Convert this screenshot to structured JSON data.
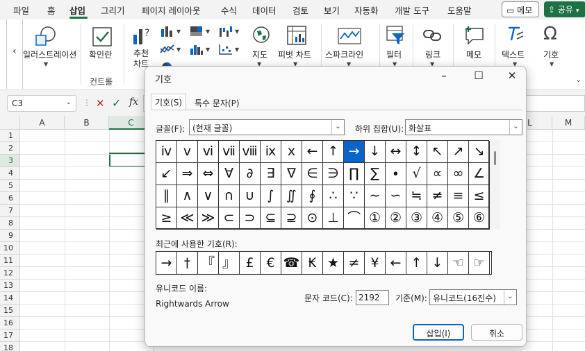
{
  "ribbon_tabs": [
    {
      "label": "파일",
      "active": false
    },
    {
      "label": "홈",
      "active": false
    },
    {
      "label": "삽입",
      "active": true
    },
    {
      "label": "그리기",
      "active": false
    },
    {
      "label": "페이지 레이아웃",
      "active": false
    },
    {
      "label": "수식",
      "active": false
    },
    {
      "label": "데이터",
      "active": false
    },
    {
      "label": "검토",
      "active": false
    },
    {
      "label": "보기",
      "active": false
    },
    {
      "label": "자동화",
      "active": false
    },
    {
      "label": "개발 도구",
      "active": false
    },
    {
      "label": "도움말",
      "active": false
    }
  ],
  "top_buttons": {
    "memo": "메모",
    "share": "공유"
  },
  "ribbon": {
    "scroll_left": "‹",
    "illustrations": "일러스트레이션",
    "checkbox": "확인란",
    "controls_group": "컨트롤",
    "recommended_charts": "추천 차트",
    "map": "지도",
    "pivot_chart": "피벗 차트",
    "sparklines": "스파크라인",
    "filter": "필터",
    "link": "링크",
    "comment": "메모",
    "text": "텍스트",
    "symbol": "기호"
  },
  "formula_bar": {
    "name_box": "C3",
    "cancel": "✕",
    "enter": "✓",
    "fx": "fx"
  },
  "sheet": {
    "columns": [
      "A",
      "B",
      "C",
      "L",
      "M"
    ],
    "rows": [
      "1",
      "2",
      "3",
      "4",
      "5",
      "6",
      "7",
      "8",
      "9",
      "10",
      "11",
      "12",
      "13",
      "14",
      "15",
      "16",
      "17",
      "18"
    ],
    "active_cell": "C3"
  },
  "dialog": {
    "title": "기호",
    "tab_symbols": "기호(S)",
    "tab_special": "특수 문자(P)",
    "font_label": "글꼴(F):",
    "font_value": "(현재 글꼴)",
    "subset_label": "하위 집합(U):",
    "subset_value": "화살표",
    "symbols": [
      "ⅳ",
      "ⅴ",
      "ⅵ",
      "ⅶ",
      "ⅷ",
      "ⅸ",
      "ⅹ",
      "←",
      "↑",
      "→",
      "↓",
      "↔",
      "↕",
      "↖",
      "↗",
      "↘",
      "↙",
      "⇒",
      "⇔",
      "∀",
      "∂",
      "∃",
      "∇",
      "∈",
      "∋",
      "∏",
      "∑",
      "∙",
      "√",
      "∝",
      "∞",
      "∠",
      "∥",
      "∧",
      "∨",
      "∩",
      "∪",
      "∫",
      "∬",
      "∮",
      "∴",
      "∵",
      "∼",
      "∽",
      "≒",
      "≠",
      "≡",
      "≤",
      "≥",
      "≪",
      "≫",
      "⊂",
      "⊃",
      "⊆",
      "⊇",
      "⊙",
      "⊥",
      "⌒",
      "①",
      "②",
      "③",
      "④",
      "⑤",
      "⑥"
    ],
    "selected_index": 9,
    "recent_label": "최근에 사용한 기호(R):",
    "recent": [
      "→",
      "†",
      "『",
      "』",
      "£",
      "€",
      "☎",
      "₭",
      "★",
      "≠",
      "¥",
      "←",
      "↑",
      "↓",
      "☜",
      "☞"
    ],
    "unicode_name_label": "유니코드 이름:",
    "unicode_name": "Rightwards Arrow",
    "char_code_label": "문자 코드(C):",
    "char_code": "2192",
    "from_label": "기준(M):",
    "from_value": "유니코드(16진수)",
    "insert": "삽입(I)",
    "cancel": "취소"
  }
}
